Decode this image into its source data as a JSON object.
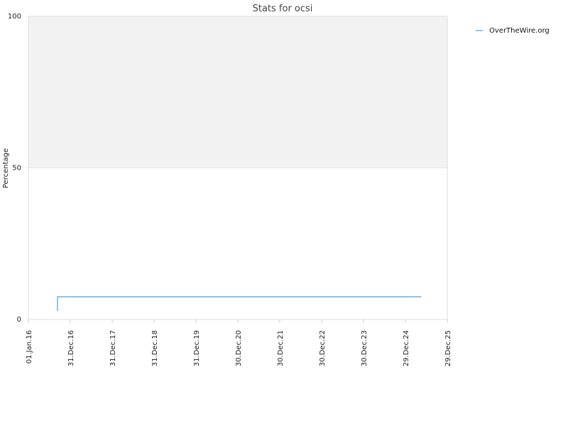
{
  "chart_data": {
    "type": "line",
    "title": "Stats for ocsi",
    "xlabel": "",
    "ylabel": "Percentage",
    "ylim": [
      0,
      100
    ],
    "xlim": [
      "2016-01-01",
      "2025-12-29"
    ],
    "y_ticks": [
      0,
      50,
      100
    ],
    "x_ticks": [
      {
        "date": "2016-01-01",
        "label": "01.Jan.16"
      },
      {
        "date": "2016-12-31",
        "label": "31.Dec.16"
      },
      {
        "date": "2017-12-31",
        "label": "31.Dec.17"
      },
      {
        "date": "2018-12-31",
        "label": "31.Dec.18"
      },
      {
        "date": "2019-12-31",
        "label": "31.Dec.19"
      },
      {
        "date": "2020-12-30",
        "label": "30.Dec.20"
      },
      {
        "date": "2021-12-30",
        "label": "30.Dec.21"
      },
      {
        "date": "2022-12-30",
        "label": "30.Dec.22"
      },
      {
        "date": "2023-12-30",
        "label": "30.Dec.23"
      },
      {
        "date": "2024-12-29",
        "label": "29.Dec.24"
      },
      {
        "date": "2025-12-29",
        "label": "29.Dec.25"
      }
    ],
    "grid": "horizontal",
    "plot_band": {
      "from": 50,
      "to": 100,
      "color": "#f2f2f2"
    },
    "legend_position": "top-right",
    "series": [
      {
        "name": "OverTheWire.org",
        "color": "#90c4ec",
        "points": [
          {
            "x": "2016-09-10",
            "y": 3
          },
          {
            "x": "2016-09-11",
            "y": 7.5
          },
          {
            "x": "2025-05-10",
            "y": 7.5
          }
        ]
      }
    ]
  }
}
